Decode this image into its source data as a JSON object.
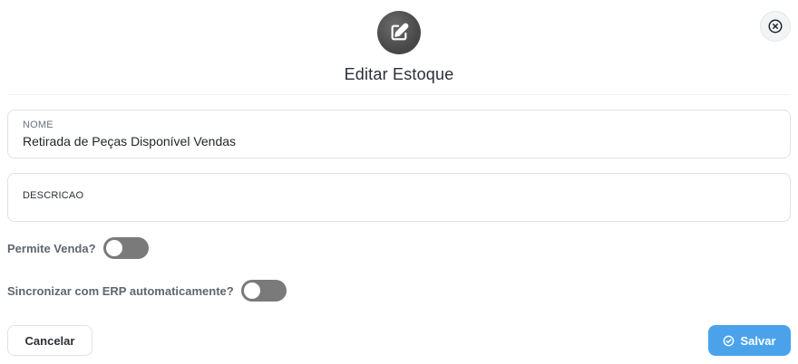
{
  "header": {
    "icon": "edit-icon",
    "title": "Editar Estoque",
    "close_icon": "close-circle-icon"
  },
  "form": {
    "nome": {
      "label": "NOME",
      "value": "Retirada de Peças Disponível Vendas"
    },
    "descricao": {
      "label": "DESCRICAO",
      "value": ""
    },
    "permite_venda": {
      "label": "Permite Venda?",
      "checked": false
    },
    "sincronizar_erp": {
      "label": "Sincronizar com ERP automaticamente?",
      "checked": false
    }
  },
  "actions": {
    "cancel_label": "Cancelar",
    "save_label": "Salvar",
    "save_icon": "check-circle-icon"
  },
  "colors": {
    "save_button": "#4aa3ea",
    "toggle_off": "#7a7a7a",
    "header_icon_bg": "#4a4a4a"
  }
}
